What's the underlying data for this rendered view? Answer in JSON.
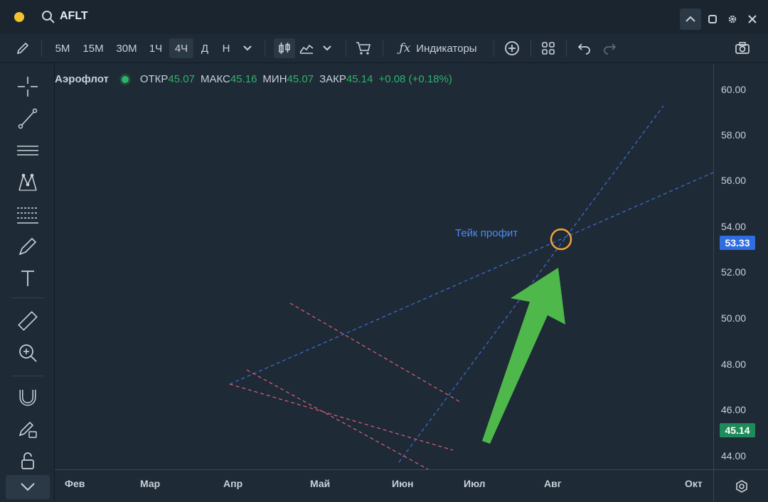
{
  "window": {
    "symbol": "AFLT"
  },
  "toolbar": {
    "timeframes": [
      "5M",
      "15M",
      "30M",
      "1Ч",
      "4Ч",
      "Д",
      "Н"
    ],
    "selected_timeframe": "4Ч",
    "indicators_label": "Индикаторы"
  },
  "legend": {
    "name": "Аэрофлот",
    "open_label": "ОТКР",
    "open": "45.07",
    "high_label": "МАКС",
    "high": "45.16",
    "low_label": "МИН",
    "low": "45.07",
    "close_label": "ЗАКР",
    "close": "45.14",
    "change": "+0.08 (+0.18%)"
  },
  "price_axis": {
    "ticks": [
      "60.00",
      "58.00",
      "56.00",
      "54.00",
      "52.00",
      "50.00",
      "48.00",
      "46.00",
      "44.00"
    ],
    "take_profit_price": "53.33",
    "last_price": "45.14"
  },
  "time_axis": {
    "ticks": [
      "Фев",
      "Мар",
      "Апр",
      "Май",
      "Июн",
      "Июл",
      "Авг",
      "Окт"
    ]
  },
  "annotations": {
    "take_profit_label": "Тейк профит"
  },
  "colors": {
    "background": "#1e2a36",
    "up": "#2fb36b",
    "down": "#e0515a",
    "take_profit_line": "#4a8cf0",
    "arrow": "#4fb84a",
    "target_circle": "#f2a23a",
    "channel_lines": "#e0607a"
  },
  "chart_data": {
    "type": "candlestick",
    "y_range": [
      43.5,
      60.5
    ],
    "key_levels": {
      "take_profit": 53.33,
      "last": 45.14
    }
  }
}
